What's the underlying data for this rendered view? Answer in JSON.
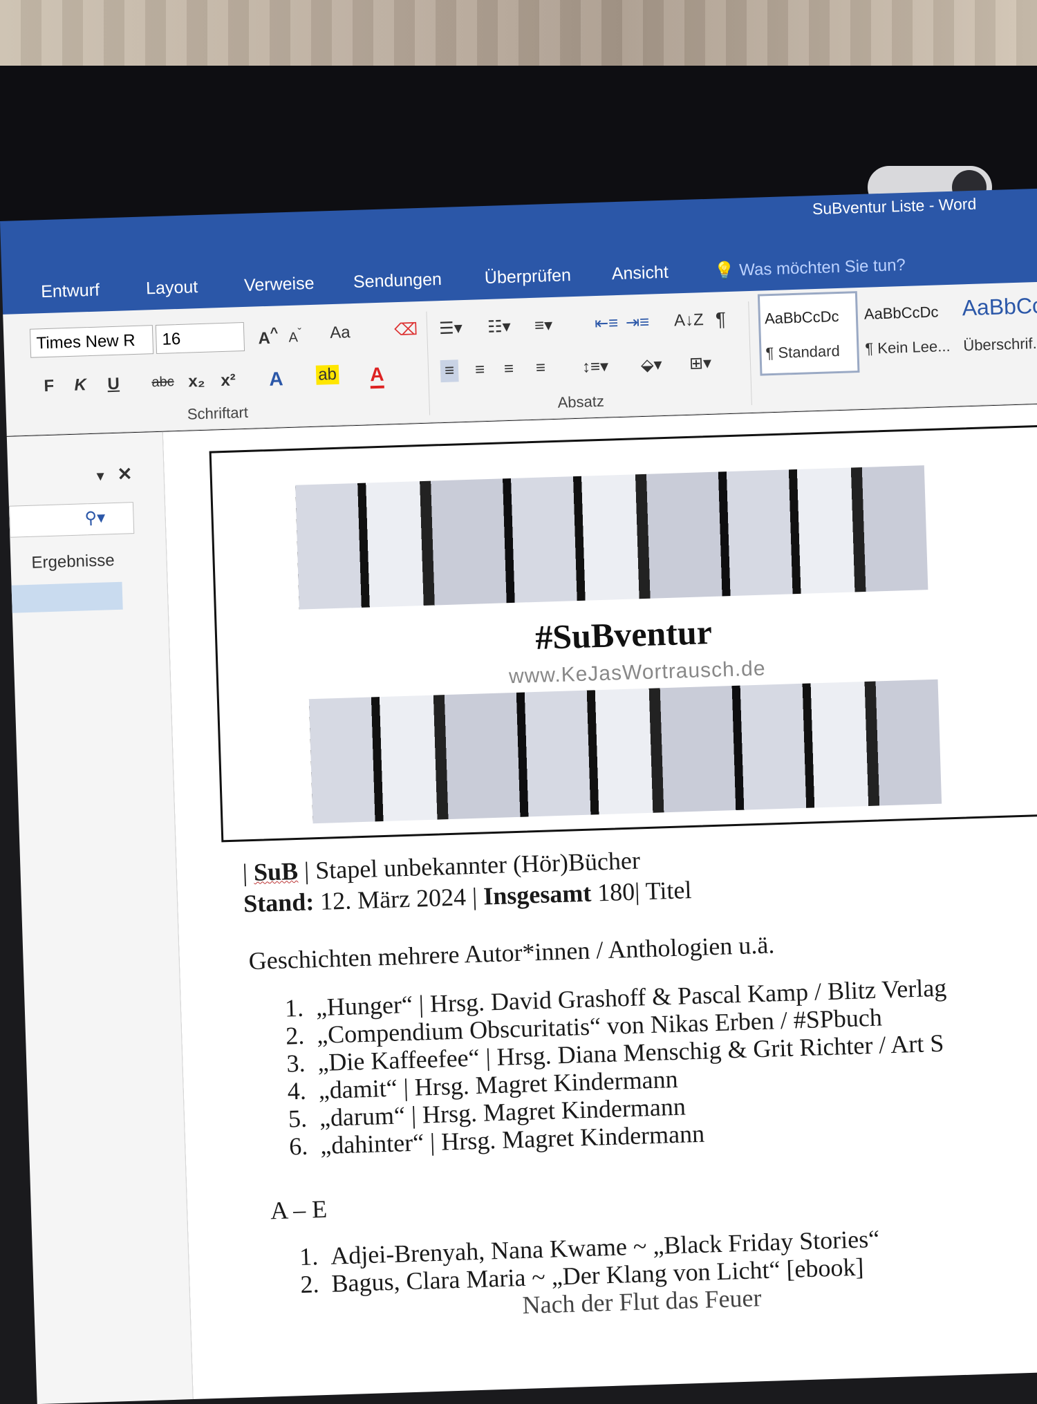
{
  "window": {
    "title": "SuBventur Liste - Word"
  },
  "tabs": [
    "Entwurf",
    "Layout",
    "Verweise",
    "Sendungen",
    "Überprüfen",
    "Ansicht"
  ],
  "tell_me": "Was möchten Sie tun?",
  "ribbon": {
    "font_name": "Times New R",
    "font_size": "16",
    "bold": "F",
    "italic": "K",
    "underline": "U",
    "strike": "abc",
    "subscript": "x₂",
    "superscript": "x²",
    "change_case": "Aa",
    "sort": "A↓Z",
    "pilcrow": "¶",
    "group_font": "Schriftart",
    "group_paragraph": "Absatz",
    "styles": [
      {
        "preview": "AaBbCcDc",
        "name": "¶ Standard"
      },
      {
        "preview": "AaBbCcDc",
        "name": "¶ Kein Lee..."
      },
      {
        "preview": "AaBbCc",
        "name": "Überschrif..."
      }
    ]
  },
  "nav_pane": {
    "results_label": "Ergebnisse"
  },
  "document": {
    "banner_hashtag": "#SuBventur",
    "banner_url": "www.KeJasWortrausch.de",
    "line1_sub": "SuB",
    "line1_rest": "Stapel unbekannter (Hör)Bücher",
    "line2_stand": "Stand:",
    "line2_date": "12. März 2024",
    "line2_insgesamt": "Insgesamt",
    "line2_count": "180",
    "line2_titel": "Titel",
    "section1_heading": "Geschichten mehrere Autor*innen / Anthologien u.ä.",
    "section1_items": [
      "„Hunger“ | Hrsg. David Grashoff & Pascal Kamp / Blitz Verlag",
      "„Compendium Obscuritatis“ von Nikas Erben / #SPbuch",
      "„Die Kaffeefee“ | Hrsg. Diana Menschig & Grit Richter / Art S",
      "„damit“ | Hrsg. Magret Kindermann",
      "„darum“ | Hrsg. Magret Kindermann",
      "„dahinter“ | Hrsg. Magret Kindermann"
    ],
    "section2_heading": "A – E",
    "section2_items": [
      "Adjei-Brenyah, Nana Kwame ~ „Black Friday Stories“",
      "Bagus, Clara Maria ~ „Der Klang von Licht“ [ebook]"
    ],
    "partial_line": "Nach der Flut das Feuer"
  }
}
